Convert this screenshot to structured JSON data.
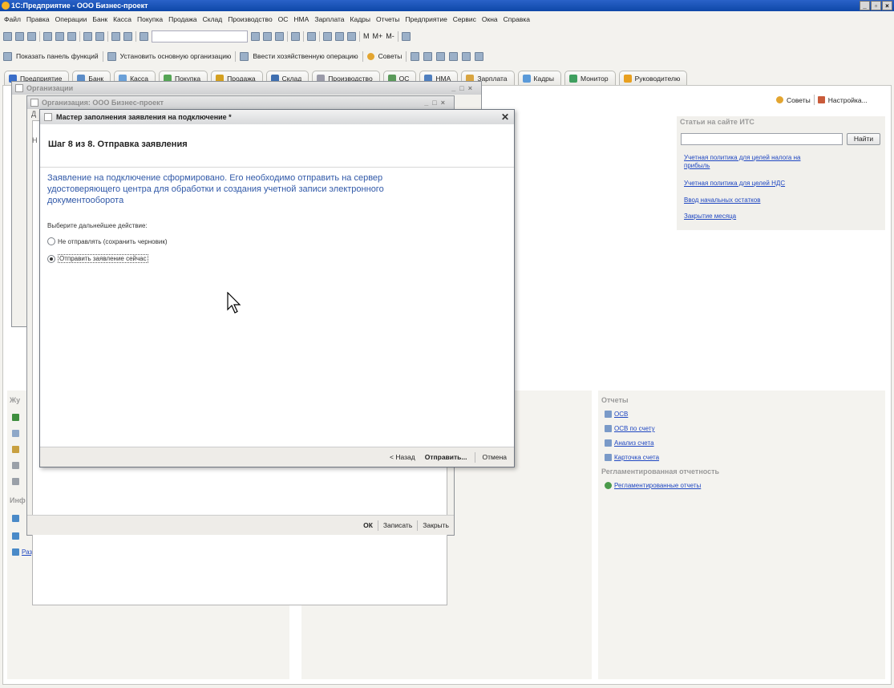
{
  "app": {
    "title": "1С:Предприятие - ООО Бизнес-проект",
    "win_controls": [
      "_",
      "▫",
      "×"
    ]
  },
  "menu": [
    "Файл",
    "Правка",
    "Операции",
    "Банк",
    "Касса",
    "Покупка",
    "Продажа",
    "Склад",
    "Производство",
    "ОС",
    "НМА",
    "Зарплата",
    "Кадры",
    "Отчеты",
    "Предприятие",
    "Сервис",
    "Окна",
    "Справка"
  ],
  "toolbar1": {
    "memory_buttons": [
      "M",
      "M+",
      "M-"
    ]
  },
  "toolbar2": {
    "show_panel": "Показать панель функций",
    "set_org": "Установить основную организацию",
    "enter_op": "Ввести хозяйственную операцию",
    "tips": "Советы"
  },
  "tabs": [
    {
      "label": "Предприятие",
      "color": "#3a6ec9"
    },
    {
      "label": "Банк",
      "color": "#5b8cc8"
    },
    {
      "label": "Касса",
      "color": "#6aa0d8"
    },
    {
      "label": "Покупка",
      "color": "#55a555"
    },
    {
      "label": "Продажа",
      "color": "#d4a020"
    },
    {
      "label": "Склад",
      "color": "#3f6fb0"
    },
    {
      "label": "Производство",
      "color": "#9a9aa8"
    },
    {
      "label": "ОС",
      "color": "#5a9a5a"
    },
    {
      "label": "НМА",
      "color": "#4f7fbf"
    },
    {
      "label": "Зарплата",
      "color": "#d9a540"
    },
    {
      "label": "Кадры",
      "color": "#5a9ad9"
    },
    {
      "label": "Монитор",
      "color": "#3f9f5f"
    },
    {
      "label": "Руководителю",
      "color": "#e8a020"
    }
  ],
  "content_toolbar": {
    "tips": "Советы",
    "settings": "Настройка..."
  },
  "its_panel": {
    "header": "Статьи на сайте ИТС",
    "find_button": "Найти",
    "links": [
      "Учетная политика для целей налога на прибыль",
      "Учетная политика для целей НДС",
      "Ввод начальных остатков",
      "Закрытие месяца"
    ]
  },
  "reports_panel": {
    "header": "Отчеты",
    "links": [
      "ОСВ",
      "ОСВ по счету",
      "Анализ счета",
      "Карточка счета"
    ],
    "reg_header": "Регламентированная отчетность",
    "reg_links": [
      "Регламентированные отчеты"
    ]
  },
  "left_panel": {
    "journal_header": "Жу",
    "info_header": "Инф",
    "links": [
      "Раздел РЦКО"
    ]
  },
  "orgs_window": {
    "title": "Организации",
    "col_stub": "Д"
  },
  "org_window": {
    "title": "Организация: ООО Бизнес-проект",
    "col_stub": "Д",
    "row_stub": "Н",
    "footer": [
      "ОК",
      "Записать",
      "Закрыть"
    ]
  },
  "dialog": {
    "title": "Мастер заполнения заявления на подключение *",
    "step": "Шаг 8 из 8. Отправка заявления",
    "message": "Заявление на подключение сформировано. Его необходимо отправить на сервер удостоверяющего центра для обработки и создания учетной записи электронного документооборота",
    "prompt": "Выберите дальнейшее действие:",
    "options": [
      {
        "label": "Не отправлять (сохранить черновик)",
        "selected": false
      },
      {
        "label": "Отправить заявление сейчас",
        "selected": true
      }
    ],
    "back": "< Назад",
    "send": "Отправить...",
    "cancel": "Отмена"
  }
}
